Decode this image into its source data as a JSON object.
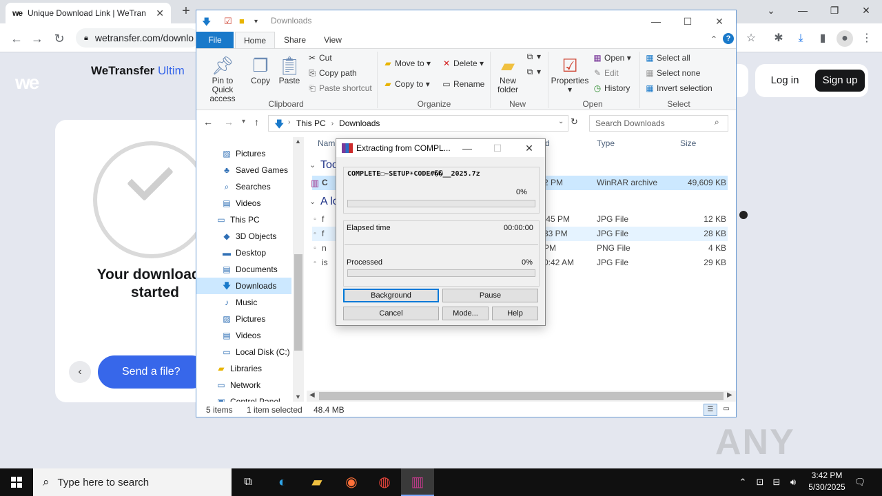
{
  "browser": {
    "tab_title": "Unique Download Link | WeTran",
    "tab_favicon": "we",
    "address": "wetransfer.com/downlo",
    "new_tab": "+"
  },
  "wetransfer": {
    "brand": "WeTransfer",
    "brand_suffix": "Ultim",
    "logo": "we",
    "download_title": "Your download h started",
    "send_button": "Send a file?",
    "login": "Log in",
    "signup": "Sign up"
  },
  "explorer": {
    "title": "Downloads",
    "ribbon_tabs": [
      "File",
      "Home",
      "Share",
      "View"
    ],
    "clipboard": {
      "pin": "Pin to Quick access",
      "copy": "Copy",
      "paste": "Paste",
      "cut": "Cut",
      "copy_path": "Copy path",
      "paste_shortcut": "Paste shortcut",
      "group": "Clipboard"
    },
    "organize": {
      "move_to": "Move to",
      "copy_to": "Copy to",
      "delete": "Delete",
      "rename": "Rename",
      "group": "Organize"
    },
    "new": {
      "new_folder": "New folder",
      "group": "New"
    },
    "open": {
      "properties": "Properties",
      "open": "Open",
      "edit": "Edit",
      "history": "History",
      "group": "Open"
    },
    "select": {
      "select_all": "Select all",
      "select_none": "Select none",
      "invert": "Invert selection",
      "group": "Select"
    },
    "breadcrumb": [
      "This PC",
      "Downloads"
    ],
    "search_placeholder": "Search Downloads",
    "nav_items": [
      {
        "label": "Pictures",
        "icon": "pictures-icon"
      },
      {
        "label": "Saved Games",
        "icon": "saved-games-icon"
      },
      {
        "label": "Searches",
        "icon": "searches-icon"
      },
      {
        "label": "Videos",
        "icon": "videos-icon"
      },
      {
        "label": "This PC",
        "icon": "this-pc-icon"
      },
      {
        "label": "3D Objects",
        "icon": "3d-objects-icon"
      },
      {
        "label": "Desktop",
        "icon": "desktop-icon"
      },
      {
        "label": "Documents",
        "icon": "documents-icon"
      },
      {
        "label": "Downloads",
        "icon": "downloads-icon"
      },
      {
        "label": "Music",
        "icon": "music-icon"
      },
      {
        "label": "Pictures",
        "icon": "pictures-icon"
      },
      {
        "label": "Videos",
        "icon": "videos-icon"
      },
      {
        "label": "Local Disk (C:)",
        "icon": "disk-icon"
      },
      {
        "label": "Libraries",
        "icon": "libraries-icon"
      },
      {
        "label": "Network",
        "icon": "network-icon"
      },
      {
        "label": "Control Panel",
        "icon": "control-panel-icon"
      }
    ],
    "columns": {
      "name": "Nam",
      "date": "d",
      "type": "Type",
      "size": "Size"
    },
    "groups": [
      "Too",
      "A lo"
    ],
    "files": [
      {
        "name": "C",
        "date": "2 PM",
        "type": "WinRAR archive",
        "size": "49,609 KB"
      },
      {
        "name": "f",
        "date": ":45 PM",
        "type": "JPG File",
        "size": "12 KB"
      },
      {
        "name": "f",
        "date": "33 PM",
        "type": "JPG File",
        "size": "28 KB"
      },
      {
        "name": "n",
        "date": "PM",
        "type": "PNG File",
        "size": "4 KB"
      },
      {
        "name": "is",
        "date": "0:42 AM",
        "type": "JPG File",
        "size": "29 KB"
      }
    ],
    "status": {
      "items": "5 items",
      "selected": "1 item selected",
      "size": "48.4 MB"
    }
  },
  "winrar": {
    "title": "Extracting from COMPL...",
    "file": "COMPLETE☐~SETUP☀CODE#��__2025.7z",
    "file_progress": "0%",
    "elapsed_label": "Elapsed time",
    "elapsed": "00:00:00",
    "processed_label": "Processed",
    "processed": "0%",
    "buttons": {
      "background": "Background",
      "pause": "Pause",
      "cancel": "Cancel",
      "mode": "Mode...",
      "help": "Help"
    }
  },
  "taskbar": {
    "search_placeholder": "Type here to search",
    "time": "3:42 PM",
    "date": "5/30/2025"
  },
  "watermark": "ANY RUN",
  "colors": {
    "accent": "#3767ea",
    "explorer_file_tab": "#1979ca",
    "selection": "#cce8ff"
  }
}
